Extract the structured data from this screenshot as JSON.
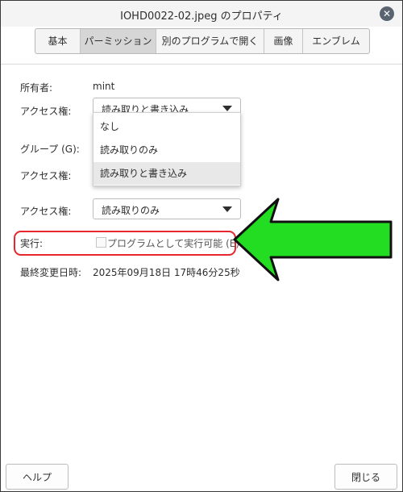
{
  "window": {
    "title": "IOHD0022-02.jpeg のプロパティ",
    "close_glyph": "✕"
  },
  "tabs": [
    {
      "label": "基本"
    },
    {
      "label": "パーミッション"
    },
    {
      "label": "別のプログラムで開く"
    },
    {
      "label": "画像"
    },
    {
      "label": "エンブレム"
    }
  ],
  "owner": {
    "label": "所有者:",
    "value": "mint",
    "access_label": "アクセス権:",
    "access_value": "読み取りと書き込み"
  },
  "dropdown_options": [
    "なし",
    "読み取りのみ",
    "読み取りと書き込み"
  ],
  "group": {
    "label": "グループ (G):",
    "access_label": "アクセス権:"
  },
  "others": {
    "access_label": "アクセス権:",
    "access_value": "読み取りのみ"
  },
  "execute": {
    "label": "実行:",
    "checkbox_label": "プログラムとして実行可能 (E)",
    "checked": false
  },
  "modified": {
    "label": "最終変更日時:",
    "value": "2025年09月18日 17時46分25秒"
  },
  "footer": {
    "help_label": "ヘルプ",
    "close_label": "閉じる"
  },
  "colors": {
    "highlight_red": "#e8262d",
    "arrow_green": "#22dd22",
    "selected_tab": "#d6d6d6"
  }
}
